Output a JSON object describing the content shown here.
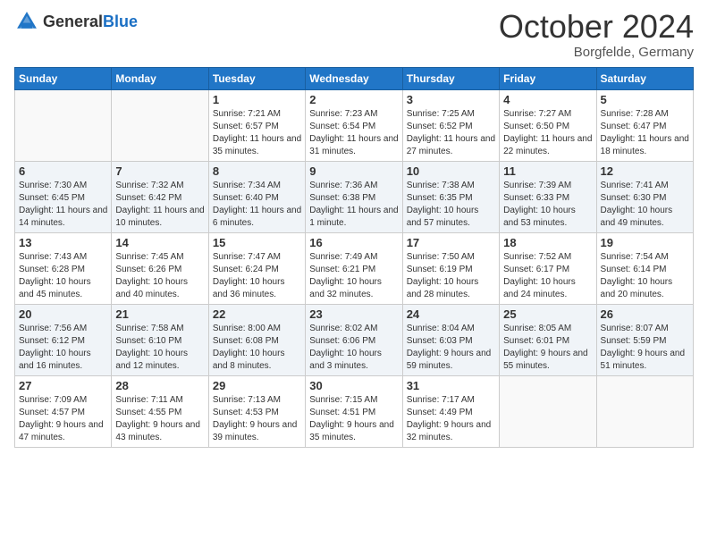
{
  "logo": {
    "general": "General",
    "blue": "Blue"
  },
  "header": {
    "month": "October 2024",
    "location": "Borgfelde, Germany"
  },
  "weekdays": [
    "Sunday",
    "Monday",
    "Tuesday",
    "Wednesday",
    "Thursday",
    "Friday",
    "Saturday"
  ],
  "weeks": [
    [
      {
        "day": "",
        "sunrise": "",
        "sunset": "",
        "daylight": ""
      },
      {
        "day": "",
        "sunrise": "",
        "sunset": "",
        "daylight": ""
      },
      {
        "day": "1",
        "sunrise": "Sunrise: 7:21 AM",
        "sunset": "Sunset: 6:57 PM",
        "daylight": "Daylight: 11 hours and 35 minutes."
      },
      {
        "day": "2",
        "sunrise": "Sunrise: 7:23 AM",
        "sunset": "Sunset: 6:54 PM",
        "daylight": "Daylight: 11 hours and 31 minutes."
      },
      {
        "day": "3",
        "sunrise": "Sunrise: 7:25 AM",
        "sunset": "Sunset: 6:52 PM",
        "daylight": "Daylight: 11 hours and 27 minutes."
      },
      {
        "day": "4",
        "sunrise": "Sunrise: 7:27 AM",
        "sunset": "Sunset: 6:50 PM",
        "daylight": "Daylight: 11 hours and 22 minutes."
      },
      {
        "day": "5",
        "sunrise": "Sunrise: 7:28 AM",
        "sunset": "Sunset: 6:47 PM",
        "daylight": "Daylight: 11 hours and 18 minutes."
      }
    ],
    [
      {
        "day": "6",
        "sunrise": "Sunrise: 7:30 AM",
        "sunset": "Sunset: 6:45 PM",
        "daylight": "Daylight: 11 hours and 14 minutes."
      },
      {
        "day": "7",
        "sunrise": "Sunrise: 7:32 AM",
        "sunset": "Sunset: 6:42 PM",
        "daylight": "Daylight: 11 hours and 10 minutes."
      },
      {
        "day": "8",
        "sunrise": "Sunrise: 7:34 AM",
        "sunset": "Sunset: 6:40 PM",
        "daylight": "Daylight: 11 hours and 6 minutes."
      },
      {
        "day": "9",
        "sunrise": "Sunrise: 7:36 AM",
        "sunset": "Sunset: 6:38 PM",
        "daylight": "Daylight: 11 hours and 1 minute."
      },
      {
        "day": "10",
        "sunrise": "Sunrise: 7:38 AM",
        "sunset": "Sunset: 6:35 PM",
        "daylight": "Daylight: 10 hours and 57 minutes."
      },
      {
        "day": "11",
        "sunrise": "Sunrise: 7:39 AM",
        "sunset": "Sunset: 6:33 PM",
        "daylight": "Daylight: 10 hours and 53 minutes."
      },
      {
        "day": "12",
        "sunrise": "Sunrise: 7:41 AM",
        "sunset": "Sunset: 6:30 PM",
        "daylight": "Daylight: 10 hours and 49 minutes."
      }
    ],
    [
      {
        "day": "13",
        "sunrise": "Sunrise: 7:43 AM",
        "sunset": "Sunset: 6:28 PM",
        "daylight": "Daylight: 10 hours and 45 minutes."
      },
      {
        "day": "14",
        "sunrise": "Sunrise: 7:45 AM",
        "sunset": "Sunset: 6:26 PM",
        "daylight": "Daylight: 10 hours and 40 minutes."
      },
      {
        "day": "15",
        "sunrise": "Sunrise: 7:47 AM",
        "sunset": "Sunset: 6:24 PM",
        "daylight": "Daylight: 10 hours and 36 minutes."
      },
      {
        "day": "16",
        "sunrise": "Sunrise: 7:49 AM",
        "sunset": "Sunset: 6:21 PM",
        "daylight": "Daylight: 10 hours and 32 minutes."
      },
      {
        "day": "17",
        "sunrise": "Sunrise: 7:50 AM",
        "sunset": "Sunset: 6:19 PM",
        "daylight": "Daylight: 10 hours and 28 minutes."
      },
      {
        "day": "18",
        "sunrise": "Sunrise: 7:52 AM",
        "sunset": "Sunset: 6:17 PM",
        "daylight": "Daylight: 10 hours and 24 minutes."
      },
      {
        "day": "19",
        "sunrise": "Sunrise: 7:54 AM",
        "sunset": "Sunset: 6:14 PM",
        "daylight": "Daylight: 10 hours and 20 minutes."
      }
    ],
    [
      {
        "day": "20",
        "sunrise": "Sunrise: 7:56 AM",
        "sunset": "Sunset: 6:12 PM",
        "daylight": "Daylight: 10 hours and 16 minutes."
      },
      {
        "day": "21",
        "sunrise": "Sunrise: 7:58 AM",
        "sunset": "Sunset: 6:10 PM",
        "daylight": "Daylight: 10 hours and 12 minutes."
      },
      {
        "day": "22",
        "sunrise": "Sunrise: 8:00 AM",
        "sunset": "Sunset: 6:08 PM",
        "daylight": "Daylight: 10 hours and 8 minutes."
      },
      {
        "day": "23",
        "sunrise": "Sunrise: 8:02 AM",
        "sunset": "Sunset: 6:06 PM",
        "daylight": "Daylight: 10 hours and 3 minutes."
      },
      {
        "day": "24",
        "sunrise": "Sunrise: 8:04 AM",
        "sunset": "Sunset: 6:03 PM",
        "daylight": "Daylight: 9 hours and 59 minutes."
      },
      {
        "day": "25",
        "sunrise": "Sunrise: 8:05 AM",
        "sunset": "Sunset: 6:01 PM",
        "daylight": "Daylight: 9 hours and 55 minutes."
      },
      {
        "day": "26",
        "sunrise": "Sunrise: 8:07 AM",
        "sunset": "Sunset: 5:59 PM",
        "daylight": "Daylight: 9 hours and 51 minutes."
      }
    ],
    [
      {
        "day": "27",
        "sunrise": "Sunrise: 7:09 AM",
        "sunset": "Sunset: 4:57 PM",
        "daylight": "Daylight: 9 hours and 47 minutes."
      },
      {
        "day": "28",
        "sunrise": "Sunrise: 7:11 AM",
        "sunset": "Sunset: 4:55 PM",
        "daylight": "Daylight: 9 hours and 43 minutes."
      },
      {
        "day": "29",
        "sunrise": "Sunrise: 7:13 AM",
        "sunset": "Sunset: 4:53 PM",
        "daylight": "Daylight: 9 hours and 39 minutes."
      },
      {
        "day": "30",
        "sunrise": "Sunrise: 7:15 AM",
        "sunset": "Sunset: 4:51 PM",
        "daylight": "Daylight: 9 hours and 35 minutes."
      },
      {
        "day": "31",
        "sunrise": "Sunrise: 7:17 AM",
        "sunset": "Sunset: 4:49 PM",
        "daylight": "Daylight: 9 hours and 32 minutes."
      },
      {
        "day": "",
        "sunrise": "",
        "sunset": "",
        "daylight": ""
      },
      {
        "day": "",
        "sunrise": "",
        "sunset": "",
        "daylight": ""
      }
    ]
  ]
}
